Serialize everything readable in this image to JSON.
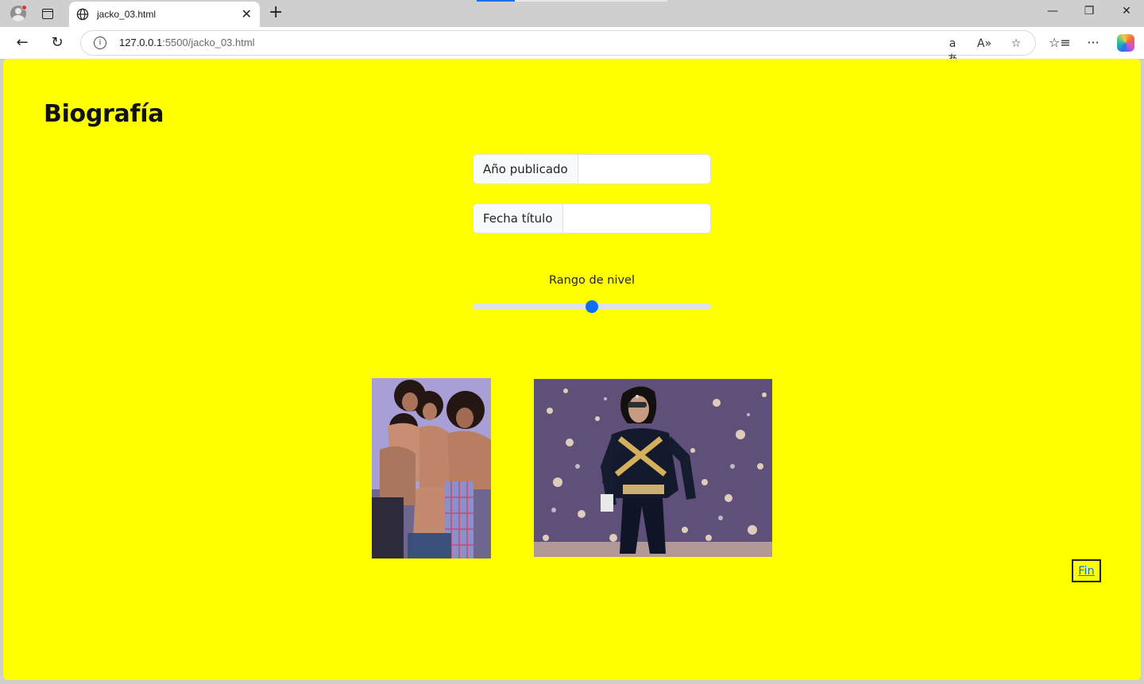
{
  "browser": {
    "tab_title": "jacko_03.html",
    "url_host": "127.0.0.1",
    "url_rest": ":5500/jacko_03.html",
    "icons": [
      "profile-icon",
      "tab-actions-icon",
      "globe-icon",
      "close-icon",
      "new-tab-icon",
      "minimize-icon",
      "restore-icon",
      "window-close-icon",
      "back-icon",
      "refresh-icon",
      "info-icon",
      "translate-icon",
      "read-aloud-icon",
      "favorite-star-icon",
      "favorites-icon",
      "more-icon",
      "copilot-icon"
    ]
  },
  "page": {
    "heading": "Biografía",
    "background": "#ffff00",
    "fields": {
      "year_label": "Año publicado",
      "year_value": "",
      "title_date_label": "Fecha título",
      "title_date_value": ""
    },
    "range": {
      "label": "Rango de nivel",
      "min": 0,
      "max": 100,
      "value": 50,
      "accent": "#0d6efd"
    },
    "images": [
      {
        "name": "group-portrait-photo"
      },
      {
        "name": "stage-performance-photo"
      }
    ],
    "fin_link": "Fin"
  }
}
